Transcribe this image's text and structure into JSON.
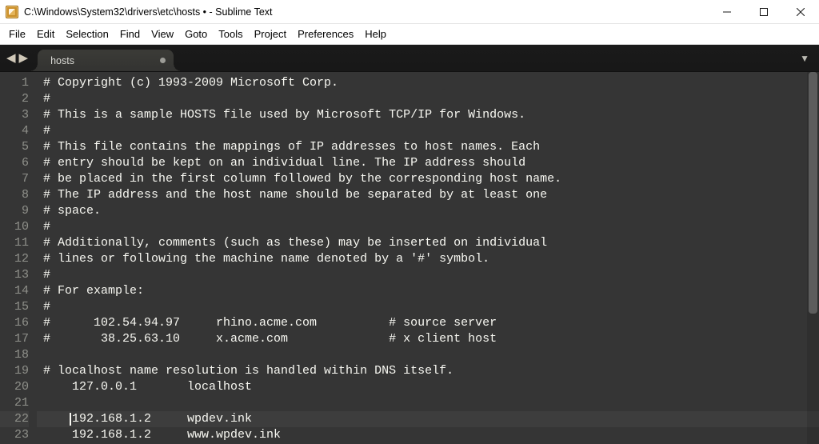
{
  "window": {
    "title": "C:\\Windows\\System32\\drivers\\etc\\hosts • - Sublime Text"
  },
  "menubar": {
    "items": [
      "File",
      "Edit",
      "Selection",
      "Find",
      "View",
      "Goto",
      "Tools",
      "Project",
      "Preferences",
      "Help"
    ]
  },
  "tabs": {
    "nav_back": "◀",
    "nav_forward": "▶",
    "overflow": "▼",
    "open": [
      {
        "label": "hosts",
        "dirty": true,
        "active": true
      }
    ]
  },
  "editor": {
    "first_line_number": 1,
    "active_line_index": 21,
    "cursor_col_ch": 4,
    "scrollbar": {
      "thumb_top_pct": 0,
      "thumb_height_pct": 65
    },
    "lines": [
      "# Copyright (c) 1993-2009 Microsoft Corp.",
      "#",
      "# This is a sample HOSTS file used by Microsoft TCP/IP for Windows.",
      "#",
      "# This file contains the mappings of IP addresses to host names. Each",
      "# entry should be kept on an individual line. The IP address should",
      "# be placed in the first column followed by the corresponding host name.",
      "# The IP address and the host name should be separated by at least one",
      "# space.",
      "#",
      "# Additionally, comments (such as these) may be inserted on individual",
      "# lines or following the machine name denoted by a '#' symbol.",
      "#",
      "# For example:",
      "#",
      "#      102.54.94.97     rhino.acme.com          # source server",
      "#       38.25.63.10     x.acme.com              # x client host",
      "",
      "# localhost name resolution is handled within DNS itself.",
      "    127.0.0.1       localhost",
      "",
      "    192.168.1.2     wpdev.ink",
      "    192.168.1.2     www.wpdev.ink"
    ]
  }
}
